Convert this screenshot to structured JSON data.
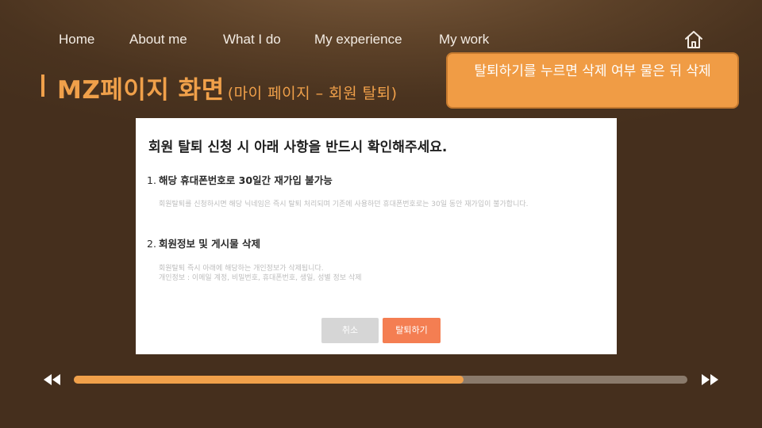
{
  "nav": {
    "items": [
      "Home",
      "About me",
      "What I do",
      "My experience",
      "My work"
    ],
    "home_icon": "home-icon"
  },
  "title": {
    "main": "MZ페이지 화면",
    "sub": "(마이 페이지 – 회원 탈퇴)"
  },
  "callout": {
    "text": "탈퇴하기를 누르면 삭제 여부 물은 뒤 삭제"
  },
  "dialog": {
    "heading": "회원 탈퇴 신청 시 아래 사항을 반드시 확인해주세요.",
    "sections": [
      {
        "number": "1.",
        "title": "해당 휴대폰번호로 30일간 재가입 불가능",
        "body": "회원탈퇴를 신청하시면 해당 닉네임은 즉시 탈퇴 처리되며 기존에 사용하던 휴대폰번호로는 30일 동안 재가입이 불가합니다."
      },
      {
        "number": "2.",
        "title": "회원정보 및 게시물 삭제",
        "body": "회원탈퇴 즉시 아래에 해당하는 개인정보가 삭제됩니다.\n개인정보 : 이메일 계정, 비밀번호, 휴대폰번호, 생일, 성별 정보 삭제"
      }
    ],
    "cancel_label": "취소",
    "withdraw_label": "탈퇴하기"
  },
  "player": {
    "progress": 0.635,
    "rewind_icon": "rewind-icon",
    "forward_icon": "fast-forward-icon"
  },
  "colors": {
    "accent": "#f0a04a",
    "callout_bg": "#f09c45",
    "withdraw_button": "#f47e52",
    "cancel_button": "#d6d6d6",
    "track": "#8a7a6b"
  }
}
